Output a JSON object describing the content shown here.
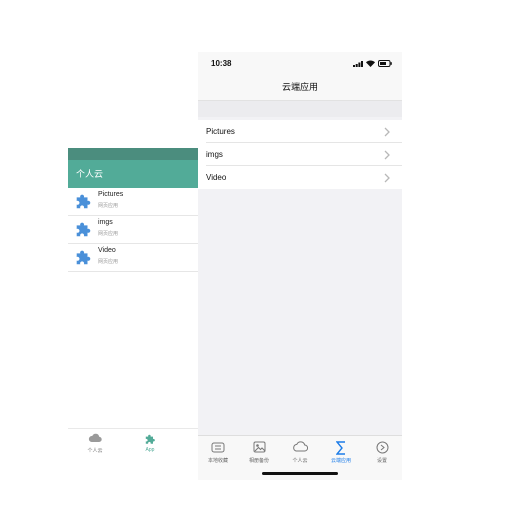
{
  "left_panel": {
    "title": "个人云",
    "items": [
      {
        "label": "Pictures",
        "sub": "网页应用"
      },
      {
        "label": "imgs",
        "sub": "网页应用"
      },
      {
        "label": "Video",
        "sub": "网页应用"
      }
    ],
    "tabs": [
      {
        "label": "个人云",
        "icon": "cloud-icon"
      },
      {
        "label": "App",
        "icon": "puzzle-icon"
      }
    ],
    "colors": {
      "header": "#52ab98",
      "puzzle": "#4a90d9"
    }
  },
  "status_bar": {
    "time": "10:38"
  },
  "nav": {
    "title": "云端应用"
  },
  "list_items": [
    {
      "label": "Pictures"
    },
    {
      "label": "imgs"
    },
    {
      "label": "Video"
    }
  ],
  "tabs": [
    {
      "label": "本地收藏",
      "icon": "local-collection-icon"
    },
    {
      "label": "相册备份",
      "icon": "photo-backup-icon"
    },
    {
      "label": "个人云",
      "icon": "cloud-icon"
    },
    {
      "label": "云端应用",
      "icon": "sigma-icon",
      "active": true
    },
    {
      "label": "设置",
      "icon": "settings-icon"
    }
  ],
  "colors": {
    "active_tab": "#1c7ce8"
  }
}
